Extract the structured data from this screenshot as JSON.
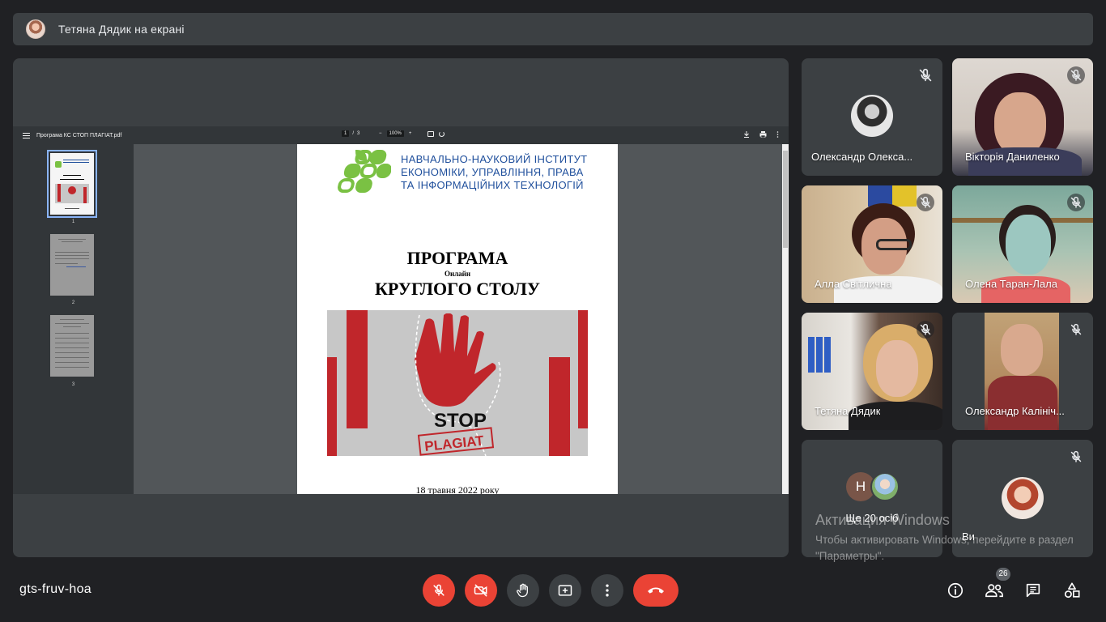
{
  "presenter": {
    "label": "Тетяна Дядик на екрані"
  },
  "pdf": {
    "file_name": "Програма КС СТОП ПЛАГІАТ.pdf",
    "page_current": "1",
    "page_sep": "/",
    "page_total": "3",
    "zoom": "100%",
    "zoom_minus": "−",
    "zoom_plus": "+",
    "thumb_labels": [
      "1",
      "2",
      "3"
    ]
  },
  "document": {
    "institute_line1": "НАВЧАЛЬНО-НАУКОВИЙ ІНСТИТУТ",
    "institute_line2": "ЕКОНОМІКИ, УПРАВЛІННЯ, ПРАВА",
    "institute_line3": "ТА ІНФОРМАЦІЙНИХ ТЕХНОЛОГІЙ",
    "title1": "ПРОГРАМА",
    "title_sub": "Онлайн",
    "title2": "КРУГЛОГО СТОЛУ",
    "poster_stop": "STOP",
    "poster_plagiat": "PLAGIAT",
    "date": "18 травня 2022 року"
  },
  "participants": [
    {
      "name": "Олександр Олекса..."
    },
    {
      "name": "Вікторія Даниленко"
    },
    {
      "name": "Алла Світлична"
    },
    {
      "name": "Олена Таран-Лала"
    },
    {
      "name": "Тетяна Дядик"
    },
    {
      "name": "Олександр Калініч..."
    },
    {
      "name": "Ще 20 осіб",
      "avatar_letter": "Н"
    },
    {
      "name": "Ви"
    }
  ],
  "watermark": {
    "title": "Активация Windows",
    "subtitle": "Чтобы активировать Windows, перейдите в раздел \"Параметры\"."
  },
  "bottom": {
    "meeting_code": "gts-fruv-hoa",
    "people_count": "26"
  },
  "colors": {
    "accent_red": "#ea4335",
    "background": "#202124",
    "tile": "#3c4043",
    "institute_blue": "#1f4f9c",
    "logo_green": "#7ac143"
  }
}
